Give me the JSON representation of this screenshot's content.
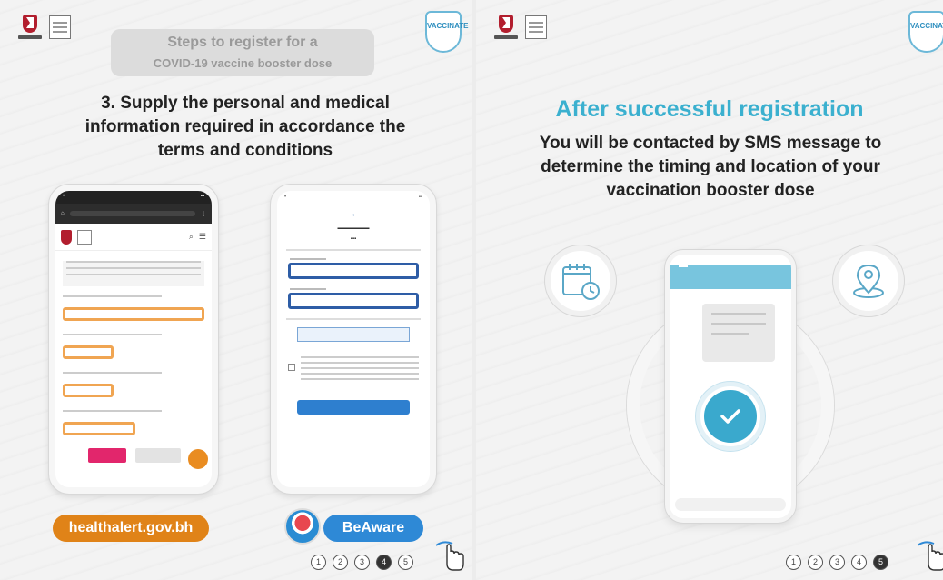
{
  "slide1": {
    "header_line1": "Steps to register for a",
    "header_line2": "COVID-19 vaccine booster dose",
    "step_line1": "3. Supply the personal and medical",
    "step_line2": "information required in accordance the",
    "step_line3": "terms and conditions",
    "site_pill": "healthalert.gov.bh",
    "beaware_pill": "BeAware",
    "vaccine_badge": "VACCINATE",
    "pages": [
      "1",
      "2",
      "3",
      "4",
      "5"
    ],
    "active_page": "4"
  },
  "slide2": {
    "title": "After successful registration",
    "body_line1": "You will be contacted by SMS message to",
    "body_line2": "determine the timing and location of your",
    "body_line3": "vaccination booster dose",
    "vaccine_badge": "VACCINATE",
    "pages": [
      "1",
      "2",
      "3",
      "4",
      "5"
    ],
    "active_page": "5"
  },
  "icons": [
    "calendar-clock-icon",
    "location-pin-icon",
    "checkmark-icon",
    "pointing-hand-icon"
  ],
  "colors": {
    "orange": "#e08318",
    "blue": "#2e89d6",
    "teal": "#3bb0cf",
    "highlight_orange": "#f0a552",
    "highlight_blue": "#2e5da6"
  }
}
